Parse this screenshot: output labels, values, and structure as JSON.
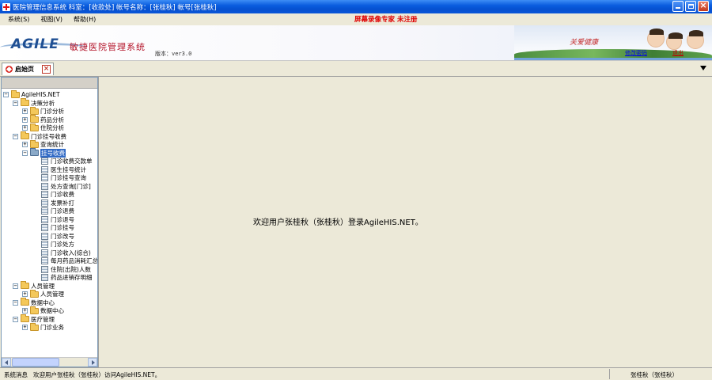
{
  "window": {
    "title": "医院管理信息系统 科室：[收款处] 帐号名称：[张桂秋] 帐号[张桂秋]",
    "icon": "red-cross-icon"
  },
  "menu": {
    "items": [
      "系统(S)",
      "视图(V)",
      "帮助(H)"
    ],
    "notice": "屏幕录像专家 未注册"
  },
  "banner": {
    "logo": "AGILE",
    "product_name": "敏捷医院管理系统",
    "version": "版本：ver3.0",
    "slogan": "关爱健康",
    "link_1": "修改密码",
    "link_2": "退出"
  },
  "tabs": {
    "home_label": "启始页",
    "close_icon": "close-icon",
    "dropdown_icon": "triangle-down-icon"
  },
  "tree": {
    "root": "AgileHIS.NET",
    "group_1": "决策分析",
    "g1_item_1": "门诊分析",
    "g1_item_2": "药品分析",
    "g1_item_3": "住院分析",
    "group_2": "门诊挂号收费",
    "g2_item_1": "查询统计",
    "g2_item_2": "挂号收费",
    "leaves": [
      "门诊收费交款单",
      "医生挂号统计",
      "门诊挂号查询",
      "处方查询[门诊]",
      "门诊收费",
      "发票补打",
      "门诊退费",
      "门诊退号",
      "门诊挂号",
      "门诊改号",
      "门诊处方",
      "门诊收入(综合)",
      "每月药品消耗汇总",
      "住院(出院)人数",
      "药品进销存明细"
    ],
    "group_3": "人员管理",
    "g3_item_1": "人员管理",
    "group_4": "数据中心",
    "g4_item_1": "数据中心",
    "group_5": "医疗管理",
    "g5_item_1": "门诊业务"
  },
  "main": {
    "welcome": "欢迎用户张桂秋（张桂秋）登录AgileHIS.NET。"
  },
  "status": {
    "label": "系统消息",
    "message": "欢迎用户张桂秋（张桂秋）访问AgileHIS.NET。",
    "user": "张桂秋（张桂秋）"
  }
}
